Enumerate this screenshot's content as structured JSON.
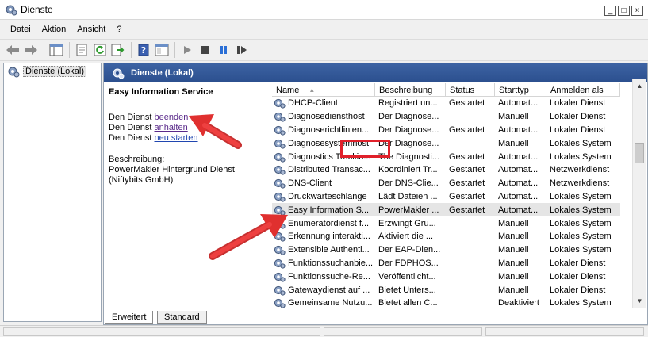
{
  "window": {
    "title": "Dienste",
    "icon": "services-gear-icon"
  },
  "title_buttons": {
    "minimize": "_",
    "maximize": "□",
    "close": "×"
  },
  "menu": [
    "Datei",
    "Aktion",
    "Ansicht",
    "?"
  ],
  "toolbar": [
    "back-arrow-icon",
    "forward-arrow-icon",
    "console-tree-icon",
    "properties-icon",
    "refresh-icon",
    "export-list-icon",
    "help-icon",
    "view-icon",
    "start-service-icon",
    "stop-service-icon",
    "pause-service-icon",
    "restart-service-icon"
  ],
  "tree": {
    "root_label": "Dienste (Lokal)"
  },
  "panel": {
    "header": "Dienste (Lokal)"
  },
  "detail": {
    "service_name": "Easy Information Service",
    "stop_prefix": "Den Dienst ",
    "stop_link": "beenden",
    "pause_prefix": "Den Dienst ",
    "pause_link": "anhalten",
    "restart_prefix": "Den Dienst ",
    "restart_link": "neu starten",
    "description_label": "Beschreibung:",
    "description_line1": "PowerMakler Hintergrund Dienst",
    "description_line2": "(Niftybits GmbH)"
  },
  "columns": {
    "name": "Name",
    "desc": "Beschreibung",
    "status": "Status",
    "start": "Starttyp",
    "login": "Anmelden als"
  },
  "services": [
    {
      "name": "DHCP-Client",
      "desc": "Registriert un...",
      "status": "Gestartet",
      "start": "Automat...",
      "login": "Lokaler Dienst"
    },
    {
      "name": "Diagnosediensthost",
      "desc": "Der Diagnose...",
      "status": "",
      "start": "Manuell",
      "login": "Lokaler Dienst"
    },
    {
      "name": "Diagnoserichtlinien...",
      "desc": "Der Diagnose...",
      "status": "Gestartet",
      "start": "Automat...",
      "login": "Lokaler Dienst"
    },
    {
      "name": "Diagnosesystemhost",
      "desc": "Der Diagnose...",
      "status": "",
      "start": "Manuell",
      "login": "Lokales System"
    },
    {
      "name": "Diagnostics Trackin...",
      "desc": "The Diagnosti...",
      "status": "Gestartet",
      "start": "Automat...",
      "login": "Lokales System"
    },
    {
      "name": "Distributed Transac...",
      "desc": "Koordiniert Tr...",
      "status": "Gestartet",
      "start": "Automat...",
      "login": "Netzwerkdienst"
    },
    {
      "name": "DNS-Client",
      "desc": "Der DNS-Clie...",
      "status": "Gestartet",
      "start": "Automat...",
      "login": "Netzwerkdienst"
    },
    {
      "name": "Druckwarteschlange",
      "desc": "Lädt Dateien ...",
      "status": "Gestartet",
      "start": "Automat...",
      "login": "Lokales System"
    },
    {
      "name": "Easy Information S...",
      "desc": "PowerMakler ...",
      "status": "Gestartet",
      "start": "Automat...",
      "login": "Lokales System"
    },
    {
      "name": "Enumeratordienst f...",
      "desc": "Erzwingt Gru...",
      "status": "",
      "start": "Manuell",
      "login": "Lokales System"
    },
    {
      "name": "Erkennung interakti...",
      "desc": "Aktiviert die ...",
      "status": "",
      "start": "Manuell",
      "login": "Lokales System"
    },
    {
      "name": "Extensible Authenti...",
      "desc": "Der EAP-Dien...",
      "status": "",
      "start": "Manuell",
      "login": "Lokales System"
    },
    {
      "name": "Funktionssuchanbie...",
      "desc": "Der FDPHOS...",
      "status": "",
      "start": "Manuell",
      "login": "Lokaler Dienst"
    },
    {
      "name": "Funktionssuche-Re...",
      "desc": "Veröffentlicht...",
      "status": "",
      "start": "Manuell",
      "login": "Lokaler Dienst"
    },
    {
      "name": "Gatewaydienst auf ...",
      "desc": "Bietet Unters...",
      "status": "",
      "start": "Manuell",
      "login": "Lokaler Dienst"
    },
    {
      "name": "Gemeinsame Nutzu...",
      "desc": "Bietet allen C...",
      "status": "",
      "start": "Deaktiviert",
      "login": "Lokales System"
    }
  ],
  "tabs": [
    "Erweitert",
    "Standard"
  ],
  "colors": {
    "header_blue": "#2b4f8e",
    "annotation_red": "#e0202a",
    "selected_row": "#e5e5e5"
  }
}
